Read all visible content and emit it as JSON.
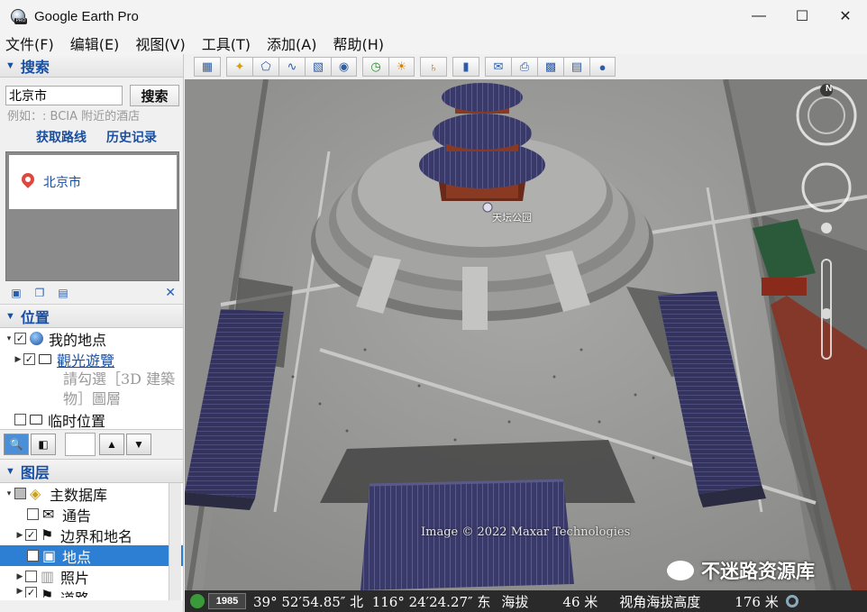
{
  "window": {
    "title": "Google Earth Pro",
    "minimize": "—",
    "maximize": "☐",
    "close": "✕"
  },
  "menu": [
    "文件(F)",
    "编辑(E)",
    "视图(V)",
    "工具(T)",
    "添加(A)",
    "帮助(H)"
  ],
  "search": {
    "header": "搜索",
    "input_value": "北京市",
    "button": "搜索",
    "hint": "例如：: BCIA 附近的酒店",
    "link_directions": "获取路线",
    "link_history": "历史记录",
    "result": "北京市"
  },
  "places": {
    "header": "位置",
    "my_places": "我的地点",
    "sightseeing": "觀光遊覽",
    "sightseeing_desc": "請勾選［3D 建築\n物］圖層",
    "temp_places": "临时位置"
  },
  "layers": {
    "header": "图层",
    "items": [
      {
        "label": "主数据库",
        "checked": "partial"
      },
      {
        "label": "通告",
        "checked": false
      },
      {
        "label": "边界和地名",
        "checked": true
      },
      {
        "label": "地点",
        "checked": true,
        "selected": true
      },
      {
        "label": "照片",
        "checked": false
      },
      {
        "label": "道路",
        "checked": true
      }
    ]
  },
  "map": {
    "place_label": "天坛公园",
    "imagery_credit": "Image © 2022 Maxar Technologies",
    "watermark": "不迷路资源库",
    "compass_north": "N"
  },
  "status": {
    "year": "1985",
    "coordinates": "39° 52′54.85″ 北  116° 24′24.27″ 东",
    "elevation_label": "海拔",
    "elevation_value": "46 米",
    "eye_alt_label": "视角海拔高度",
    "eye_alt_value": "176 米"
  },
  "colors": {
    "accent": "#1a4fa0",
    "selection": "#2d7fd3",
    "status_bg": "#2a2a2a"
  }
}
